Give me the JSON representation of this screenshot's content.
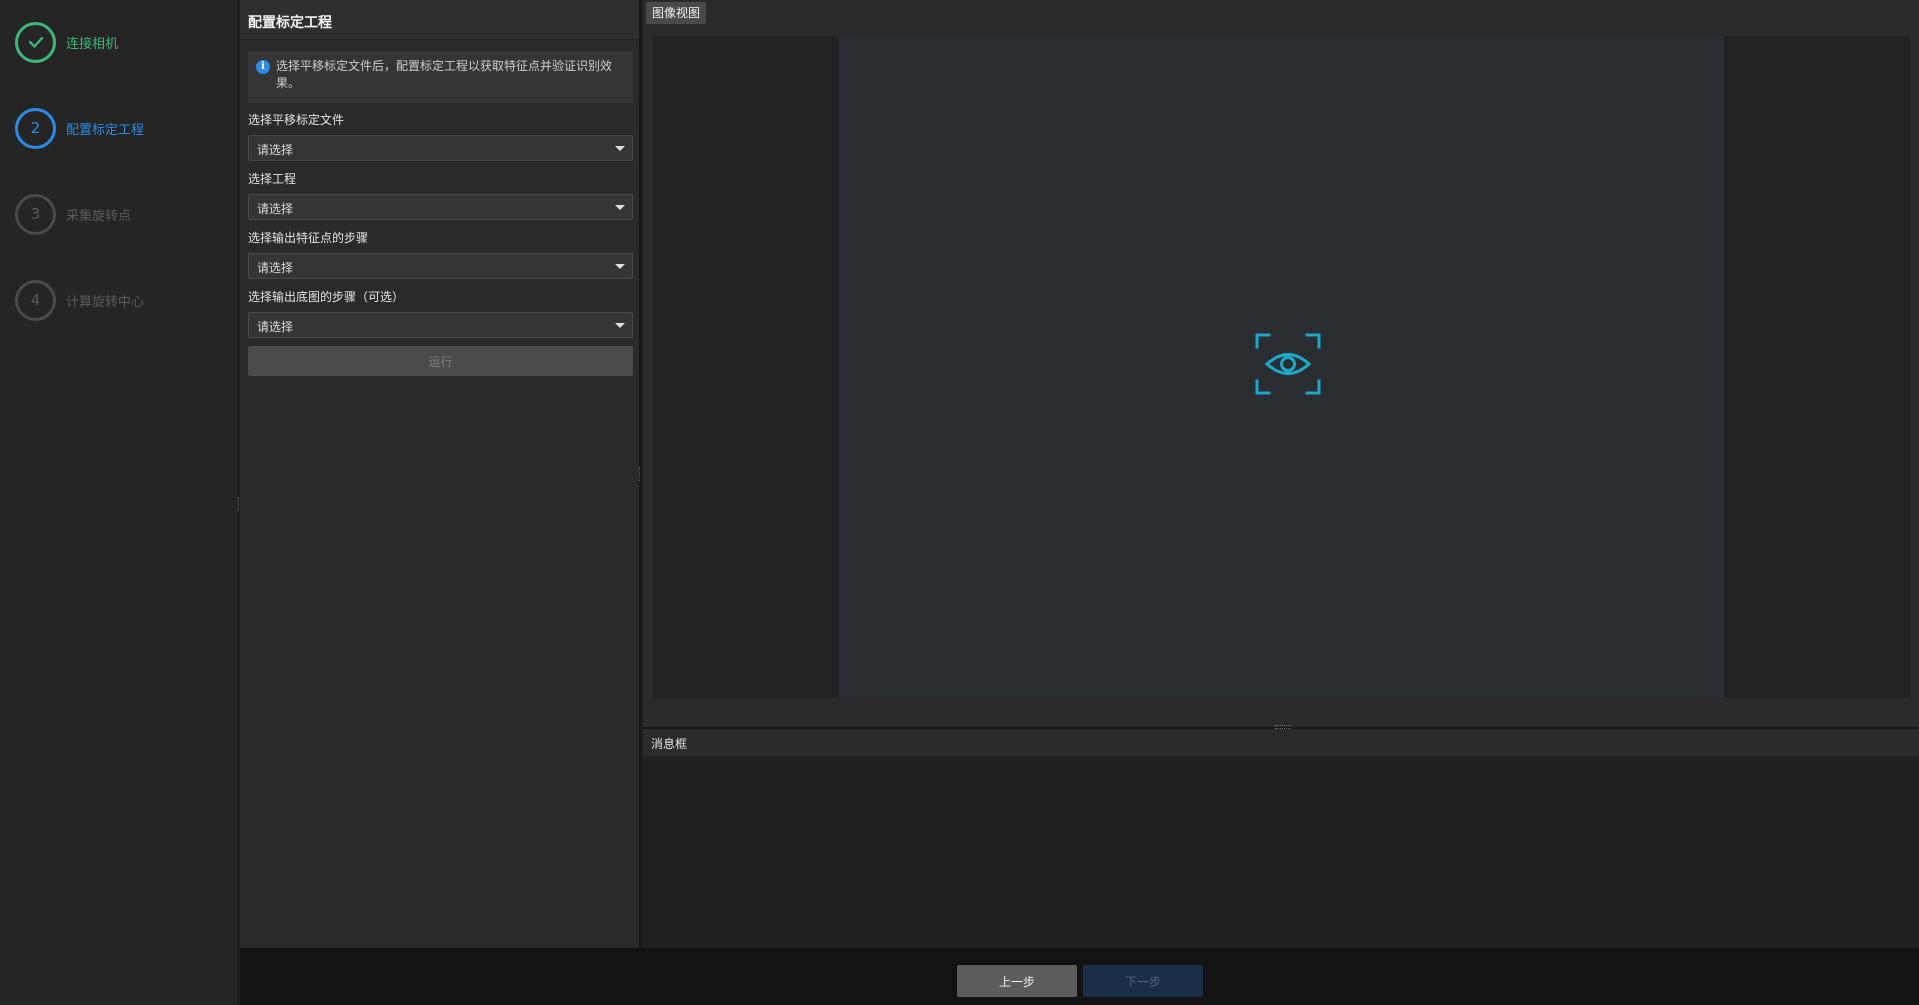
{
  "steps": [
    {
      "num": "1",
      "label": "连接相机",
      "state": "done"
    },
    {
      "num": "2",
      "label": "配置标定工程",
      "state": "active"
    },
    {
      "num": "3",
      "label": "采集旋转点",
      "state": "pending"
    },
    {
      "num": "4",
      "label": "计算旋转中心",
      "state": "pending"
    }
  ],
  "config": {
    "title": "配置标定工程",
    "info": "选择平移标定文件后，配置标定工程以获取特征点并验证识别效果。",
    "fields": [
      {
        "label": "选择平移标定文件",
        "value": "请选择"
      },
      {
        "label": "选择工程",
        "value": "请选择"
      },
      {
        "label": "选择输出特征点的步骤",
        "value": "请选择"
      },
      {
        "label": "选择输出底图的步骤（可选）",
        "value": "请选择"
      }
    ],
    "run_label": "运行"
  },
  "image_view": {
    "tab": "图像视图",
    "icon": "eye-scan-icon",
    "accent": "#1fa8c9"
  },
  "message": {
    "title": "消息框"
  },
  "footer": {
    "prev_label": "上一步",
    "next_label": "下一步"
  }
}
